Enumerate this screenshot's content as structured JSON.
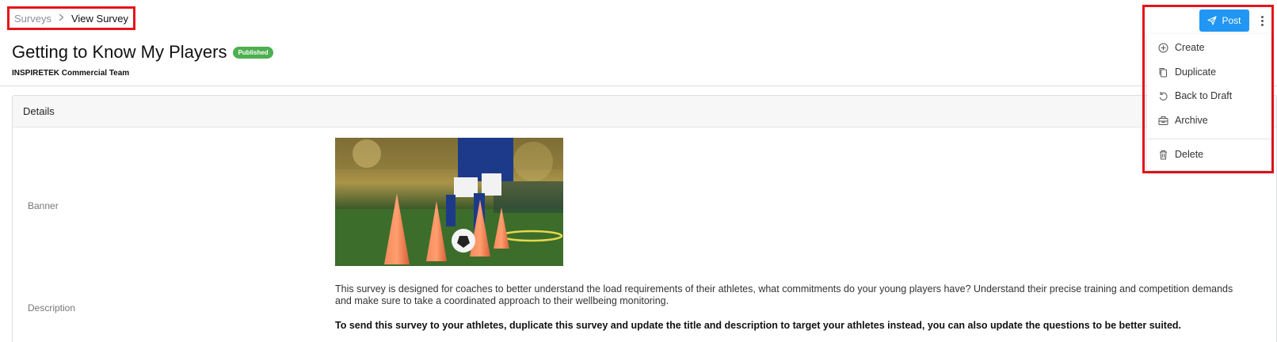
{
  "breadcrumb": {
    "root": "Surveys",
    "current": "View Survey"
  },
  "survey": {
    "title": "Getting to Know My Players",
    "status": "Published",
    "team": "INSPIRETEK Commercial Team"
  },
  "details": {
    "header": "Details",
    "banner_label": "Banner",
    "description_label": "Description",
    "description": "This survey is designed for coaches to better understand the load requirements of their athletes, what commitments do your young players have? Understand their precise training and competition demands and make sure to take a coordinated approach to their wellbeing monitoring.",
    "note": "To send this survey to your athletes, duplicate this survey and update the title and description to target your athletes instead, you can also update the questions to be better suited."
  },
  "actions": {
    "post_label": "Post",
    "menu": [
      {
        "label": "Create",
        "icon": "plus-circle-icon"
      },
      {
        "label": "Duplicate",
        "icon": "copy-icon"
      },
      {
        "label": "Back to Draft",
        "icon": "undo-icon"
      },
      {
        "label": "Archive",
        "icon": "archive-icon"
      },
      {
        "label": "Delete",
        "icon": "trash-icon"
      }
    ]
  },
  "colors": {
    "primary": "#2196f3",
    "success": "#4caf50",
    "highlight": "#e4161b"
  }
}
